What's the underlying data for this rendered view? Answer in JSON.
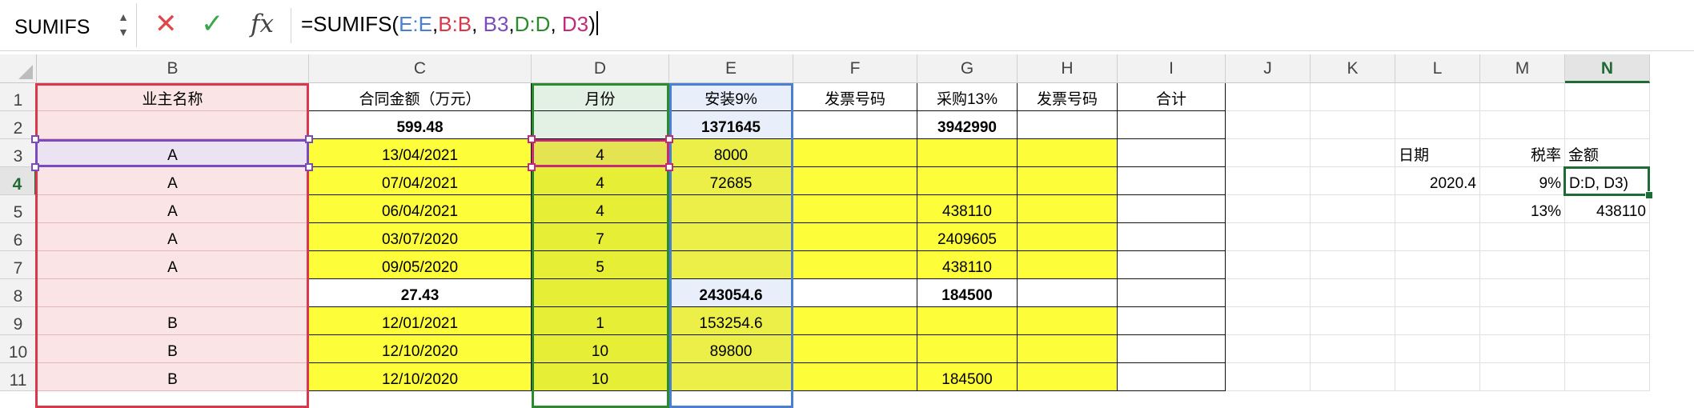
{
  "formula_bar": {
    "name_box": "SUMIFS",
    "cancel_icon": "cross-icon",
    "enter_icon": "check-icon",
    "fx_label": "fx",
    "formula_parts": [
      {
        "text": "=SUMIFS(",
        "color": "#000000"
      },
      {
        "text": "E:E",
        "color": "#4a7fd6"
      },
      {
        "text": ",",
        "color": "#000000"
      },
      {
        "text": "B:B",
        "color": "#d9374a"
      },
      {
        "text": ", ",
        "color": "#000000"
      },
      {
        "text": "B3",
        "color": "#7a4bbf"
      },
      {
        "text": ",",
        "color": "#000000"
      },
      {
        "text": "D:D",
        "color": "#2c8a2e"
      },
      {
        "text": ", ",
        "color": "#000000"
      },
      {
        "text": "D3",
        "color": "#c4297a"
      },
      {
        "text": ")",
        "color": "#000000"
      }
    ]
  },
  "columns": [
    "B",
    "C",
    "D",
    "E",
    "F",
    "G",
    "H",
    "I",
    "J",
    "K",
    "L",
    "M",
    "N"
  ],
  "selected_column": "N",
  "rows": [
    "1",
    "2",
    "3",
    "4",
    "5",
    "6",
    "7",
    "8",
    "9",
    "10",
    "11"
  ],
  "selected_row": "4",
  "cells": {
    "B1": "业主名称",
    "C1": "合同金额（万元）",
    "D1": "月份",
    "E1": "安装9%",
    "F1": "发票号码",
    "G1": "采购13%",
    "H1": "发票号码",
    "I1": "合计",
    "C2": "599.48",
    "E2": "1371645",
    "G2": "3942990",
    "B3": "A",
    "C3": "13/04/2021",
    "D3": "4",
    "E3": "8000",
    "B4": "A",
    "C4": "07/04/2021",
    "D4": "4",
    "E4": "72685",
    "B5": "A",
    "C5": "06/04/2021",
    "D5": "4",
    "G5": "438110",
    "B6": "A",
    "C6": "03/07/2020",
    "D6": "7",
    "G6": "2409605",
    "B7": "A",
    "C7": "09/05/2020",
    "D7": "5",
    "G7": "438110",
    "C8": "27.43",
    "E8": "243054.6",
    "G8": "184500",
    "B9": "B",
    "C9": "12/01/2021",
    "D9": "1",
    "E9": "153254.6",
    "B10": "B",
    "C10": "12/10/2020",
    "D10": "10",
    "E10": "89800",
    "B11": "B",
    "C11": "12/10/2020",
    "D11": "10",
    "G11": "184500",
    "L3": "日期",
    "M3": "税率",
    "N3": "金额",
    "L4": "2020.4",
    "M4": "9%",
    "N4": "D:D, D3)",
    "M5": "13%",
    "N5": "438110"
  },
  "colors": {
    "yellow": "#fdfd3a",
    "pink_fill": "#fbe4e6",
    "green_fill": "#e3f1e4",
    "blue_fill": "#e8effb",
    "purple_fill": "#ebe3f2",
    "ref_red": "#d9374a",
    "ref_green": "#2c8a2e",
    "ref_blue": "#4a7fd6",
    "ref_purple": "#7a4bbf",
    "ref_magenta": "#c4297a",
    "active_green": "#1e6b36"
  }
}
